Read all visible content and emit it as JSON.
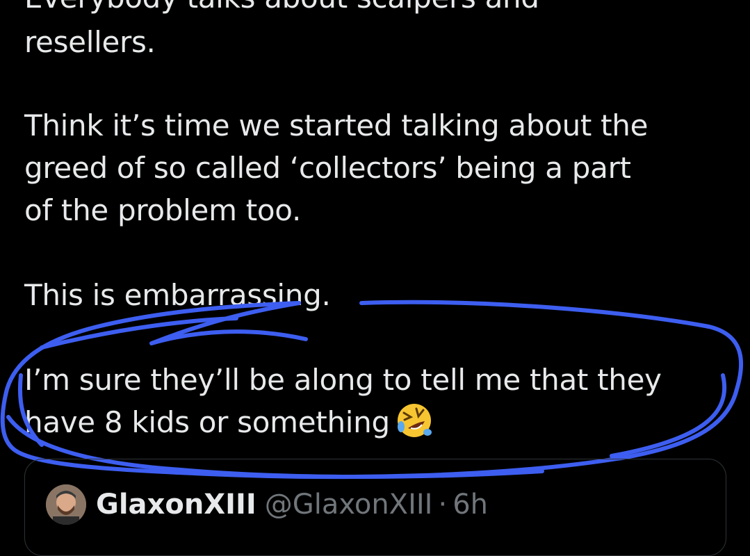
{
  "tweet": {
    "line_cut": "Everybody talks about scalpers and",
    "line_1": "resellers.",
    "line_2": "Think it’s time we started talking about the",
    "line_3": "greed of so called ‘collectors’ being a part",
    "line_4": "of the problem too.",
    "line_5": "This is embarrassing.",
    "line_6": "I’m sure they’ll be along to tell me that they",
    "line_7": "have 8 kids or something",
    "emoji_icon": "rolling-on-the-floor-laughing-emoji"
  },
  "quoted_tweet": {
    "name": "GlaxonXIII",
    "handle": "@GlaxonXIII",
    "separator": "·",
    "time": "6h"
  },
  "colors": {
    "background": "#000000",
    "text": "#e7e9ea",
    "muted": "#71767b",
    "scribble": "#3d5ef0",
    "border": "#2f3336"
  }
}
